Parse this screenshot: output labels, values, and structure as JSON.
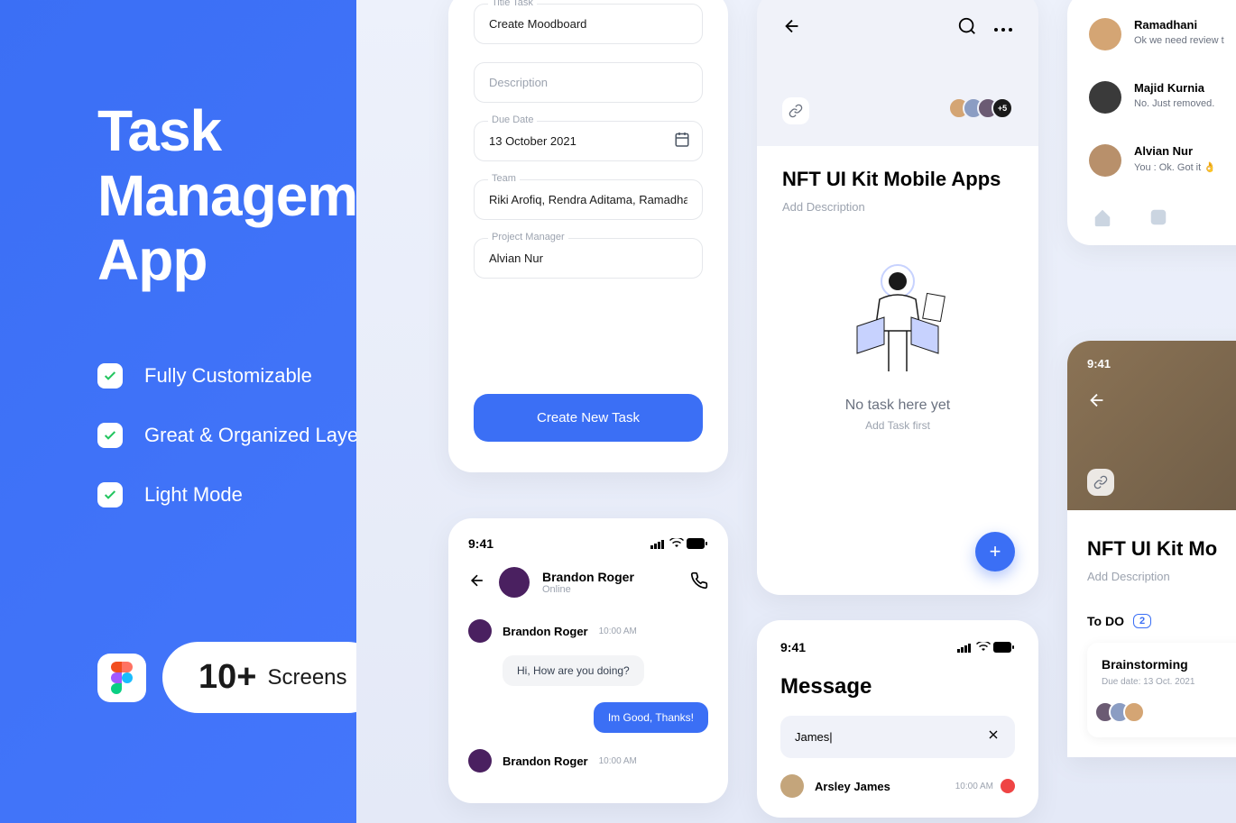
{
  "hero": {
    "title_line1": "Task",
    "title_line2": "Management",
    "title_line3": "App",
    "features": [
      "Fully Customizable",
      "Great & Organized Layer",
      "Light Mode"
    ],
    "screens_num": "10+",
    "screens_label": "Screens"
  },
  "task_form": {
    "title_label": "Title Task",
    "title_value": "Create Moodboard",
    "desc_placeholder": "Description",
    "due_label": "Due Date",
    "due_value": "13 October 2021",
    "team_label": "Team",
    "team_value": "Riki Arofiq, Rendra Aditama, Ramadhani",
    "pm_label": "Project Manager",
    "pm_value": "Alvian Nur",
    "button": "Create New Task"
  },
  "chat": {
    "time": "9:41",
    "name": "Brandon Roger",
    "status": "Online",
    "messages": [
      {
        "name": "Brandon Roger",
        "time": "10:00 AM",
        "text": "Hi, How are you doing?",
        "mine": false
      },
      {
        "text": "Im Good, Thanks!",
        "mine": true
      },
      {
        "name": "Brandon Roger",
        "time": "10:00 AM"
      }
    ]
  },
  "project": {
    "title": "NFT UI Kit Mobile Apps",
    "desc": "Add Description",
    "avatar_more": "+5",
    "empty_title": "No task here yet",
    "empty_sub": "Add Task first"
  },
  "messages": {
    "time": "9:41",
    "title": "Message",
    "search": "James|",
    "contact": "Arsley James",
    "contact_time": "10:00 AM"
  },
  "chat_list": {
    "items": [
      {
        "name": "Ramadhani",
        "msg": "Ok we need review t"
      },
      {
        "name": "Majid Kurnia",
        "msg": "No. Just removed."
      },
      {
        "name": "Alvian Nur",
        "msg": "You : Ok. Got it 👌"
      }
    ]
  },
  "project2": {
    "time": "9:41",
    "title": "NFT UI Kit Mo",
    "desc": "Add Description",
    "todo_label": "To DO",
    "todo_count": "2",
    "card_title": "Brainstorming",
    "card_due": "Due date: 13 Oct. 2021"
  }
}
